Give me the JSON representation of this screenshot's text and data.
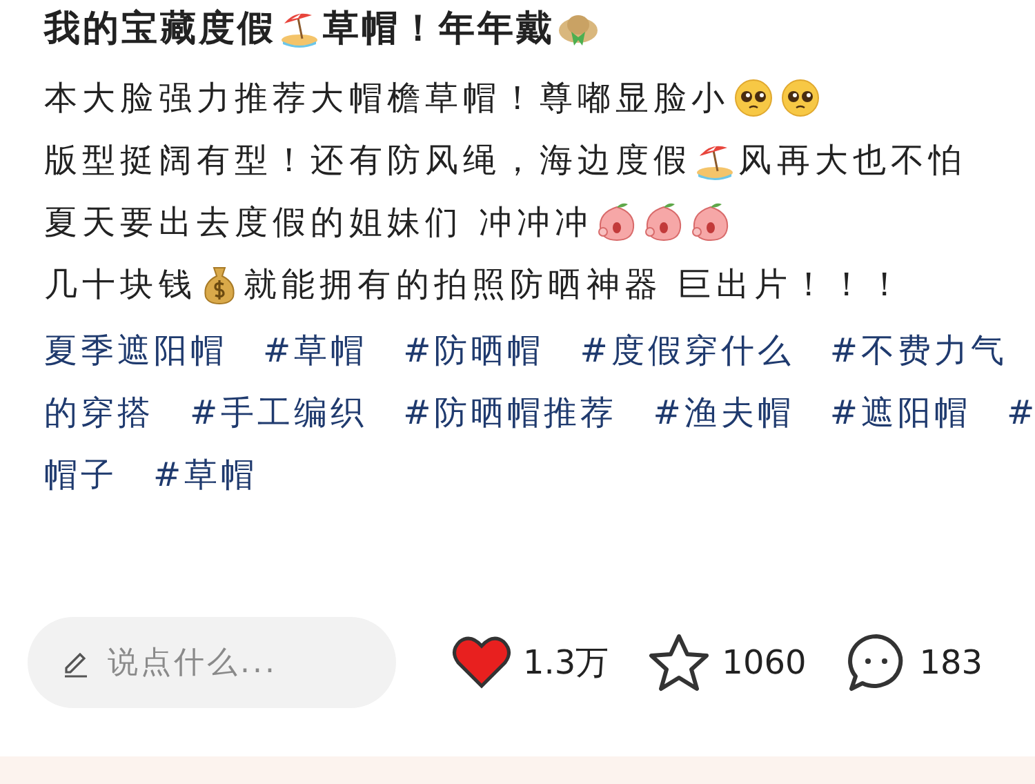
{
  "title": [
    {
      "kind": "text",
      "text": "我的宝藏度假"
    },
    {
      "kind": "beach"
    },
    {
      "kind": "text",
      "text": "草帽！年年戴"
    },
    {
      "kind": "hat"
    }
  ],
  "body": [
    [
      {
        "kind": "text",
        "text": "本大脸强力推荐大帽檐草帽！尊嘟显脸小"
      },
      {
        "kind": "pleading"
      },
      {
        "kind": "pleading"
      }
    ],
    [
      {
        "kind": "text",
        "text": "版型挺阔有型！还有防风绳，海边度假"
      },
      {
        "kind": "beach"
      },
      {
        "kind": "text",
        "text": "风再大也不怕"
      }
    ],
    [
      {
        "kind": "text",
        "text": "夏天要出去度假的姐妹们 冲冲冲"
      },
      {
        "kind": "peach"
      },
      {
        "kind": "peach"
      },
      {
        "kind": "peach"
      }
    ],
    [
      {
        "kind": "text",
        "text": "几十块钱"
      },
      {
        "kind": "moneybag"
      },
      {
        "kind": "text",
        "text": "就能拥有的拍照防晒神器 巨出片！！！"
      }
    ]
  ],
  "tag_lines": [
    [
      "夏季遮阳帽",
      "#草帽",
      "#防晒帽",
      "#度假穿什么",
      "#不费力气"
    ],
    [
      "的穿搭",
      "#手工编织",
      "#防晒帽推荐",
      "#渔夫帽",
      "#遮阳帽",
      "#"
    ],
    [
      "帽子",
      "#草帽"
    ]
  ],
  "comment_field": {
    "placeholder": "说点什么..."
  },
  "actions": [
    {
      "kind": "like",
      "count": "1.3万",
      "active": true
    },
    {
      "kind": "collect",
      "count": "1060",
      "active": false
    },
    {
      "kind": "comment",
      "count": "183"
    }
  ]
}
